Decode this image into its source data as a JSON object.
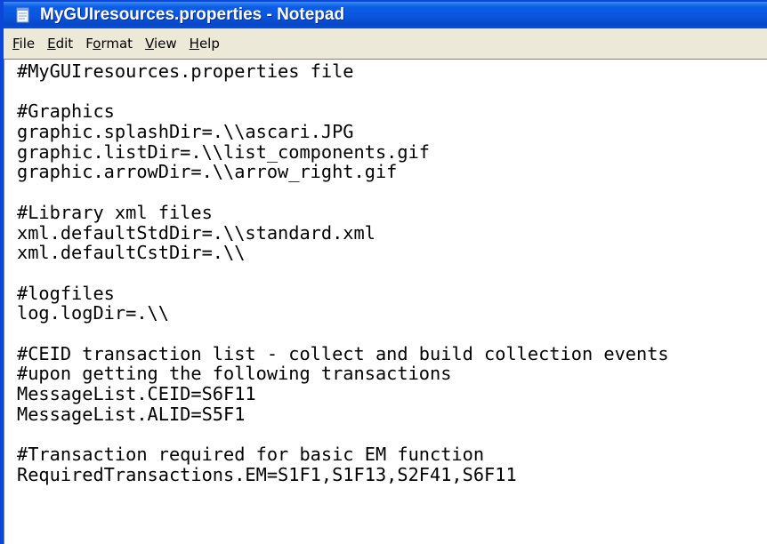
{
  "window": {
    "title": "MyGUIresources.properties - Notepad"
  },
  "menu": [
    {
      "accel": "F",
      "rest": "ile"
    },
    {
      "accel": "E",
      "rest": "dit"
    },
    {
      "pre": "F",
      "accel": "o",
      "rest": "rmat"
    },
    {
      "accel": "V",
      "rest": "iew"
    },
    {
      "accel": "H",
      "rest": "elp"
    }
  ],
  "editor": {
    "lines": [
      "#MyGUIresources.properties file",
      "",
      "#Graphics",
      "graphic.splashDir=.\\\\ascari.JPG",
      "graphic.listDir=.\\\\list_components.gif",
      "graphic.arrowDir=.\\\\arrow_right.gif",
      "",
      "#Library xml files",
      "xml.defaultStdDir=.\\\\standard.xml",
      "xml.defaultCstDir=.\\\\",
      "",
      "#logfiles",
      "log.logDir=.\\\\",
      "",
      "#CEID transaction list - collect and build collection events",
      "#upon getting the following transactions",
      "MessageList.CEID=S6F11",
      "MessageList.ALID=S5F1",
      "",
      "#Transaction required for basic EM function",
      "RequiredTransactions.EM=S1F1,S1F13,S2F41,S6F11"
    ]
  },
  "colors": {
    "titlebar": "#0a55dc",
    "menubar": "#ece9d8",
    "editor_background": "#ffffff"
  },
  "icons": {
    "app": "notepad-icon"
  }
}
